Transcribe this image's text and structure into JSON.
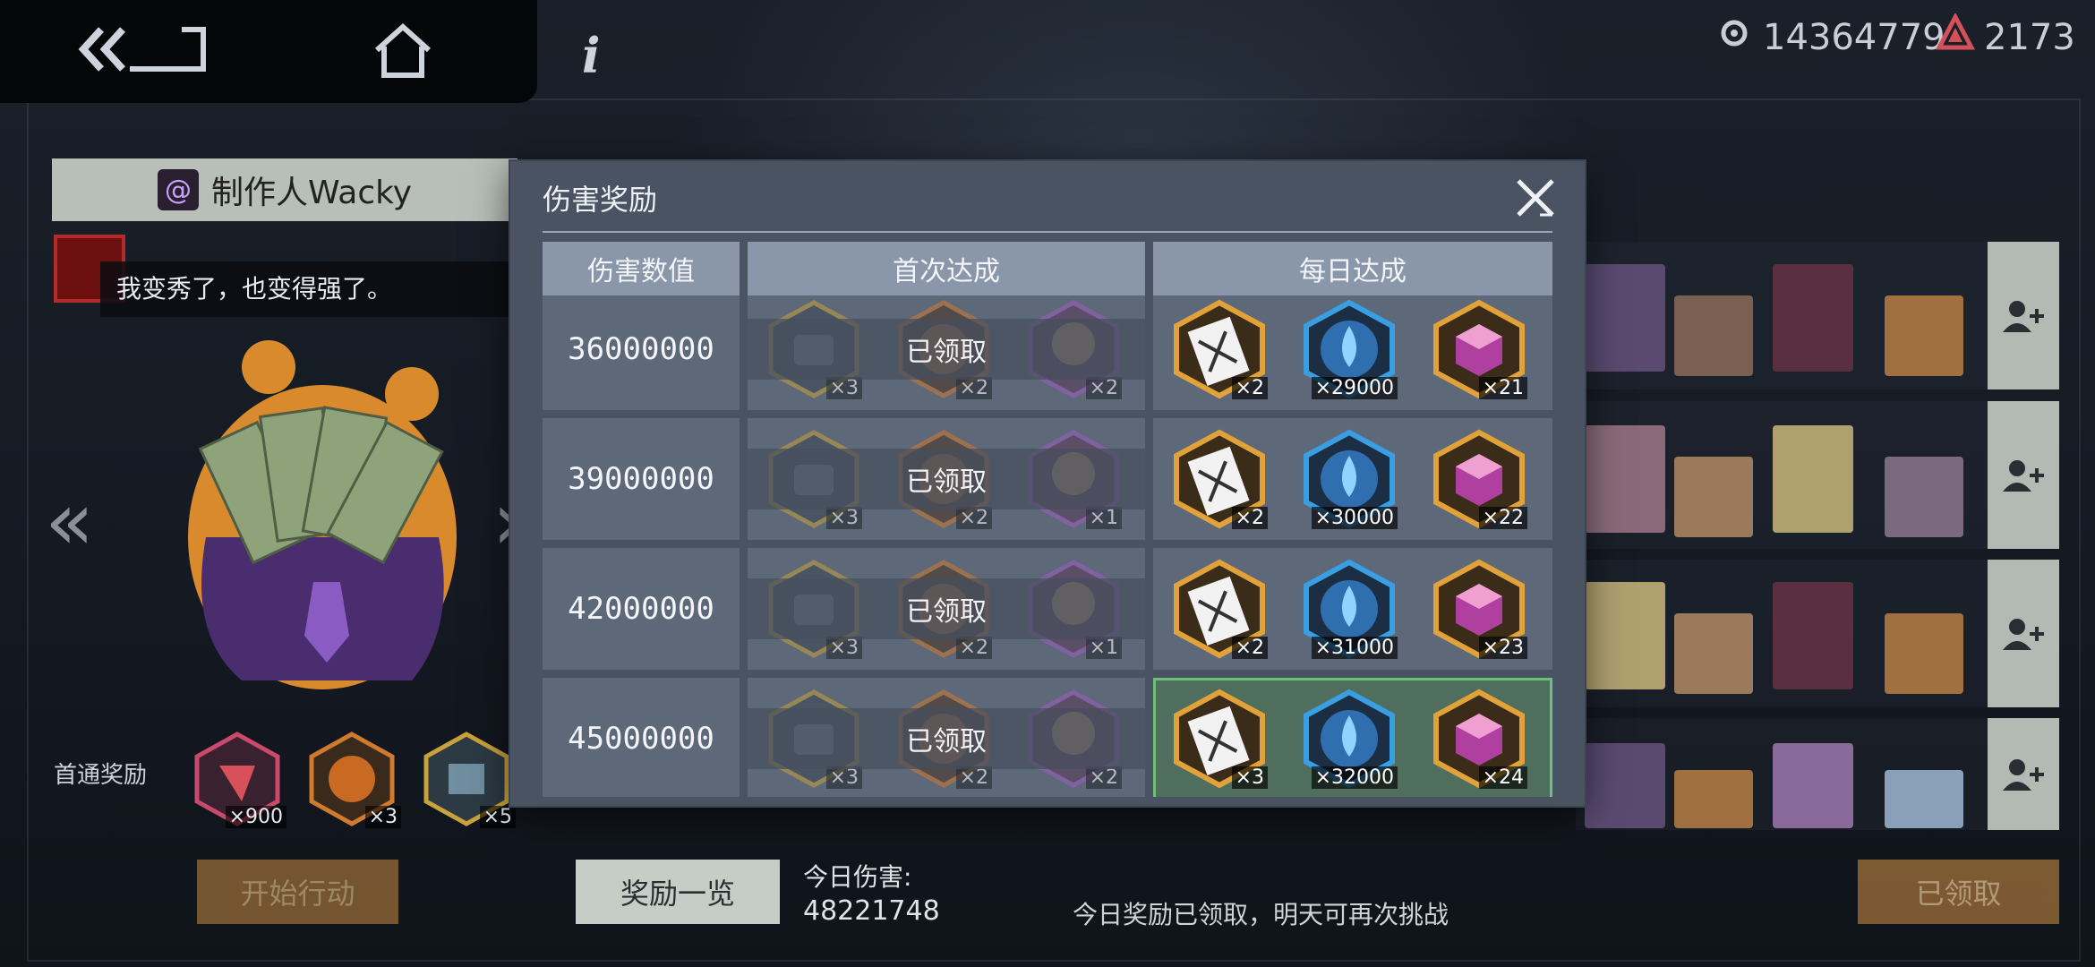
{
  "currency": {
    "coins": "14364779",
    "gems": "2173"
  },
  "left_panel": {
    "creator": "制作人Wacky",
    "quote": "我变秀了，也变得强了。",
    "first_clear_label": "首通奖励",
    "first_clear_items": [
      {
        "icon": "red-crystal-icon",
        "qty": "×900",
        "color": "#c94a6b"
      },
      {
        "icon": "orange-orb-icon",
        "qty": "×3",
        "color": "#d07a2d"
      },
      {
        "icon": "hex-chip-icon",
        "qty": "×5",
        "color": "#c9a23a"
      }
    ],
    "start_button": "开始行动"
  },
  "modal": {
    "title": "伤害奖励",
    "headers": [
      "伤害数值",
      "首次达成",
      "每日达成"
    ],
    "claimed_label": "已领取",
    "rows": [
      {
        "damage": "36000000",
        "first": [
          {
            "icon": "hamster-chip-icon",
            "qty": "×3"
          },
          {
            "icon": "orange-orb-icon",
            "qty": "×2"
          },
          {
            "icon": "character-shard-icon",
            "qty": "×2"
          }
        ],
        "daily": [
          {
            "icon": "ticket-icon",
            "qty": "×2"
          },
          {
            "icon": "water-drop-icon",
            "qty": "×29000"
          },
          {
            "icon": "cube-icon",
            "qty": "×21"
          }
        ],
        "active": false
      },
      {
        "damage": "39000000",
        "first": [
          {
            "icon": "hamster-chip-icon",
            "qty": "×3"
          },
          {
            "icon": "orange-orb-icon",
            "qty": "×2"
          },
          {
            "icon": "character-shard-icon",
            "qty": "×1"
          }
        ],
        "daily": [
          {
            "icon": "ticket-icon",
            "qty": "×2"
          },
          {
            "icon": "water-drop-icon",
            "qty": "×30000"
          },
          {
            "icon": "cube-icon",
            "qty": "×22"
          }
        ],
        "active": false
      },
      {
        "damage": "42000000",
        "first": [
          {
            "icon": "hamster-chip-icon",
            "qty": "×3"
          },
          {
            "icon": "orange-orb-icon",
            "qty": "×2"
          },
          {
            "icon": "character-shard-icon",
            "qty": "×1"
          }
        ],
        "daily": [
          {
            "icon": "ticket-icon",
            "qty": "×2"
          },
          {
            "icon": "water-drop-icon",
            "qty": "×31000"
          },
          {
            "icon": "cube-icon",
            "qty": "×23"
          }
        ],
        "active": false
      },
      {
        "damage": "45000000",
        "first": [
          {
            "icon": "hamster-chip-icon",
            "qty": "×3"
          },
          {
            "icon": "orange-orb-icon",
            "qty": "×2"
          },
          {
            "icon": "character-shard-icon",
            "qty": "×2"
          }
        ],
        "daily": [
          {
            "icon": "ticket-icon",
            "qty": "×3"
          },
          {
            "icon": "water-drop-icon",
            "qty": "×32000"
          },
          {
            "icon": "cube-icon",
            "qty": "×24"
          }
        ],
        "active": true
      }
    ]
  },
  "bottom": {
    "reward_list_button": "奖励一览",
    "today_damage_label": "今日伤害:",
    "today_damage_value": "48221748",
    "notice": "今日奖励已领取，明天可再次挑战",
    "claimed_button": "已领取"
  },
  "colors": {
    "modal_bg": "#4a5362",
    "header_bg": "#8a96aa",
    "cell_bg": "#5d6879",
    "active_border": "#6fbe7e",
    "gold_frame": "#e2a23a",
    "blue_frame": "#3a9fe2"
  }
}
